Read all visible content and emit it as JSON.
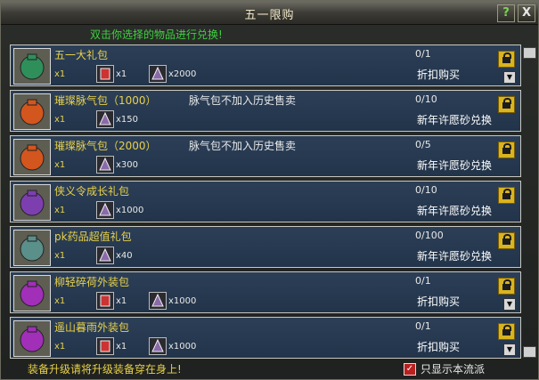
{
  "window": {
    "title": "五一限购",
    "help_label": "?",
    "close_label": "X"
  },
  "hint": "双击你选择的物品进行兑换!",
  "items": [
    {
      "name": "五一大礼包",
      "note": "",
      "qty": "x1",
      "costs": [
        "x1",
        "x2000"
      ],
      "count": "0/1",
      "exchange": "折扣购买",
      "has_dropdown": true,
      "icon": "green-gift-bag-icon",
      "icon_color": "#2f8f5a"
    },
    {
      "name": "璀璨脉气包（1000）",
      "note": "脉气包不加入历史售卖",
      "qty": "x1",
      "costs": [
        "x150"
      ],
      "count": "0/10",
      "exchange": "新年许愿砂兑换",
      "has_dropdown": false,
      "icon": "orange-pouch-icon",
      "icon_color": "#d2561e"
    },
    {
      "name": "璀璨脉气包（2000）",
      "note": "脉气包不加入历史售卖",
      "qty": "x1",
      "costs": [
        "x300"
      ],
      "count": "0/5",
      "exchange": "新年许愿砂兑换",
      "has_dropdown": false,
      "icon": "orange-pouch-icon",
      "icon_color": "#d2561e"
    },
    {
      "name": "侠义令成长礼包",
      "note": "",
      "qty": "x1",
      "costs": [
        "x1000"
      ],
      "count": "0/10",
      "exchange": "新年许愿砂兑换",
      "has_dropdown": false,
      "icon": "purple-gift-box-icon",
      "icon_color": "#7d3fb0"
    },
    {
      "name": "pk药品超值礼包",
      "note": "",
      "qty": "x1",
      "costs": [
        "x40"
      ],
      "count": "0/100",
      "exchange": "新年许愿砂兑换",
      "has_dropdown": false,
      "icon": "teal-chest-icon",
      "icon_color": "#5a8f8a"
    },
    {
      "name": "柳轻碎荷外装包",
      "note": "",
      "qty": "x1",
      "costs": [
        "x1",
        "x1000"
      ],
      "count": "0/1",
      "exchange": "折扣购买",
      "has_dropdown": true,
      "icon": "purple-pouch-icon",
      "icon_color": "#a12fb8"
    },
    {
      "name": "遥山暮雨外装包",
      "note": "",
      "qty": "x1",
      "costs": [
        "x1",
        "x1000"
      ],
      "count": "0/1",
      "exchange": "折扣购买",
      "has_dropdown": true,
      "icon": "purple-pouch-icon",
      "icon_color": "#a12fb8"
    }
  ],
  "footer": {
    "tip": "装备升级请将升级装备穿在身上!",
    "checkbox_label": "只显示本流派",
    "checkbox_checked": true
  },
  "colors": {
    "item_name": "#e8d14a",
    "hint": "#3fd03f",
    "row_bg": "#2c3f57"
  }
}
